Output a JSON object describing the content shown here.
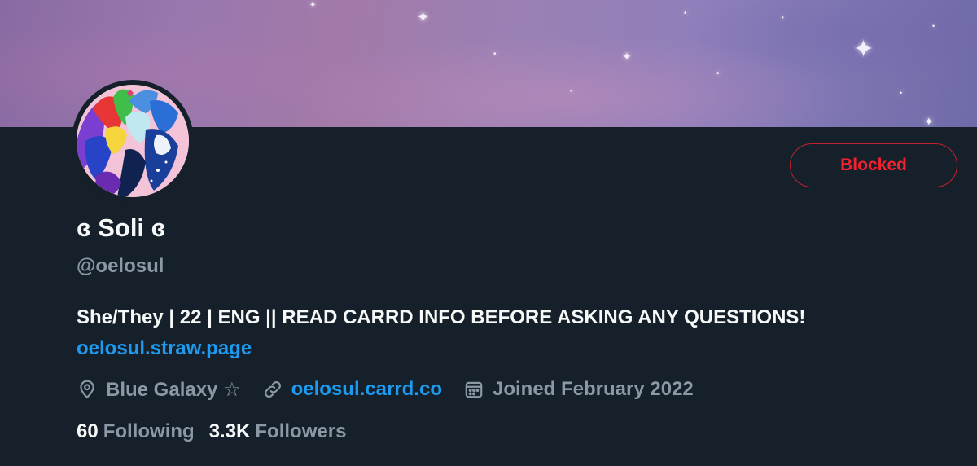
{
  "profile": {
    "display_name": "ɞ Soli ɞ",
    "handle": "@oelosul",
    "bio_text": "She/They | 22 | ENG || READ CARRD INFO BEFORE ASKING ANY QUESTIONS!",
    "bio_link": "oelosul.straw.page",
    "location": "Blue Galaxy ☆",
    "website": "oelosul.carrd.co",
    "joined": "Joined February 2022",
    "following_count": "60",
    "following_label": "Following",
    "followers_count": "3.3K",
    "followers_label": "Followers"
  },
  "actions": {
    "blocked_label": "Blocked"
  },
  "icons": {
    "location": "location-pin-icon",
    "link": "link-icon",
    "calendar": "calendar-icon"
  },
  "colors": {
    "background": "#15202b",
    "text_primary": "#f7f9f9",
    "text_secondary": "#8b98a5",
    "link": "#1d9bf0",
    "blocked_red": "#f4212e"
  }
}
